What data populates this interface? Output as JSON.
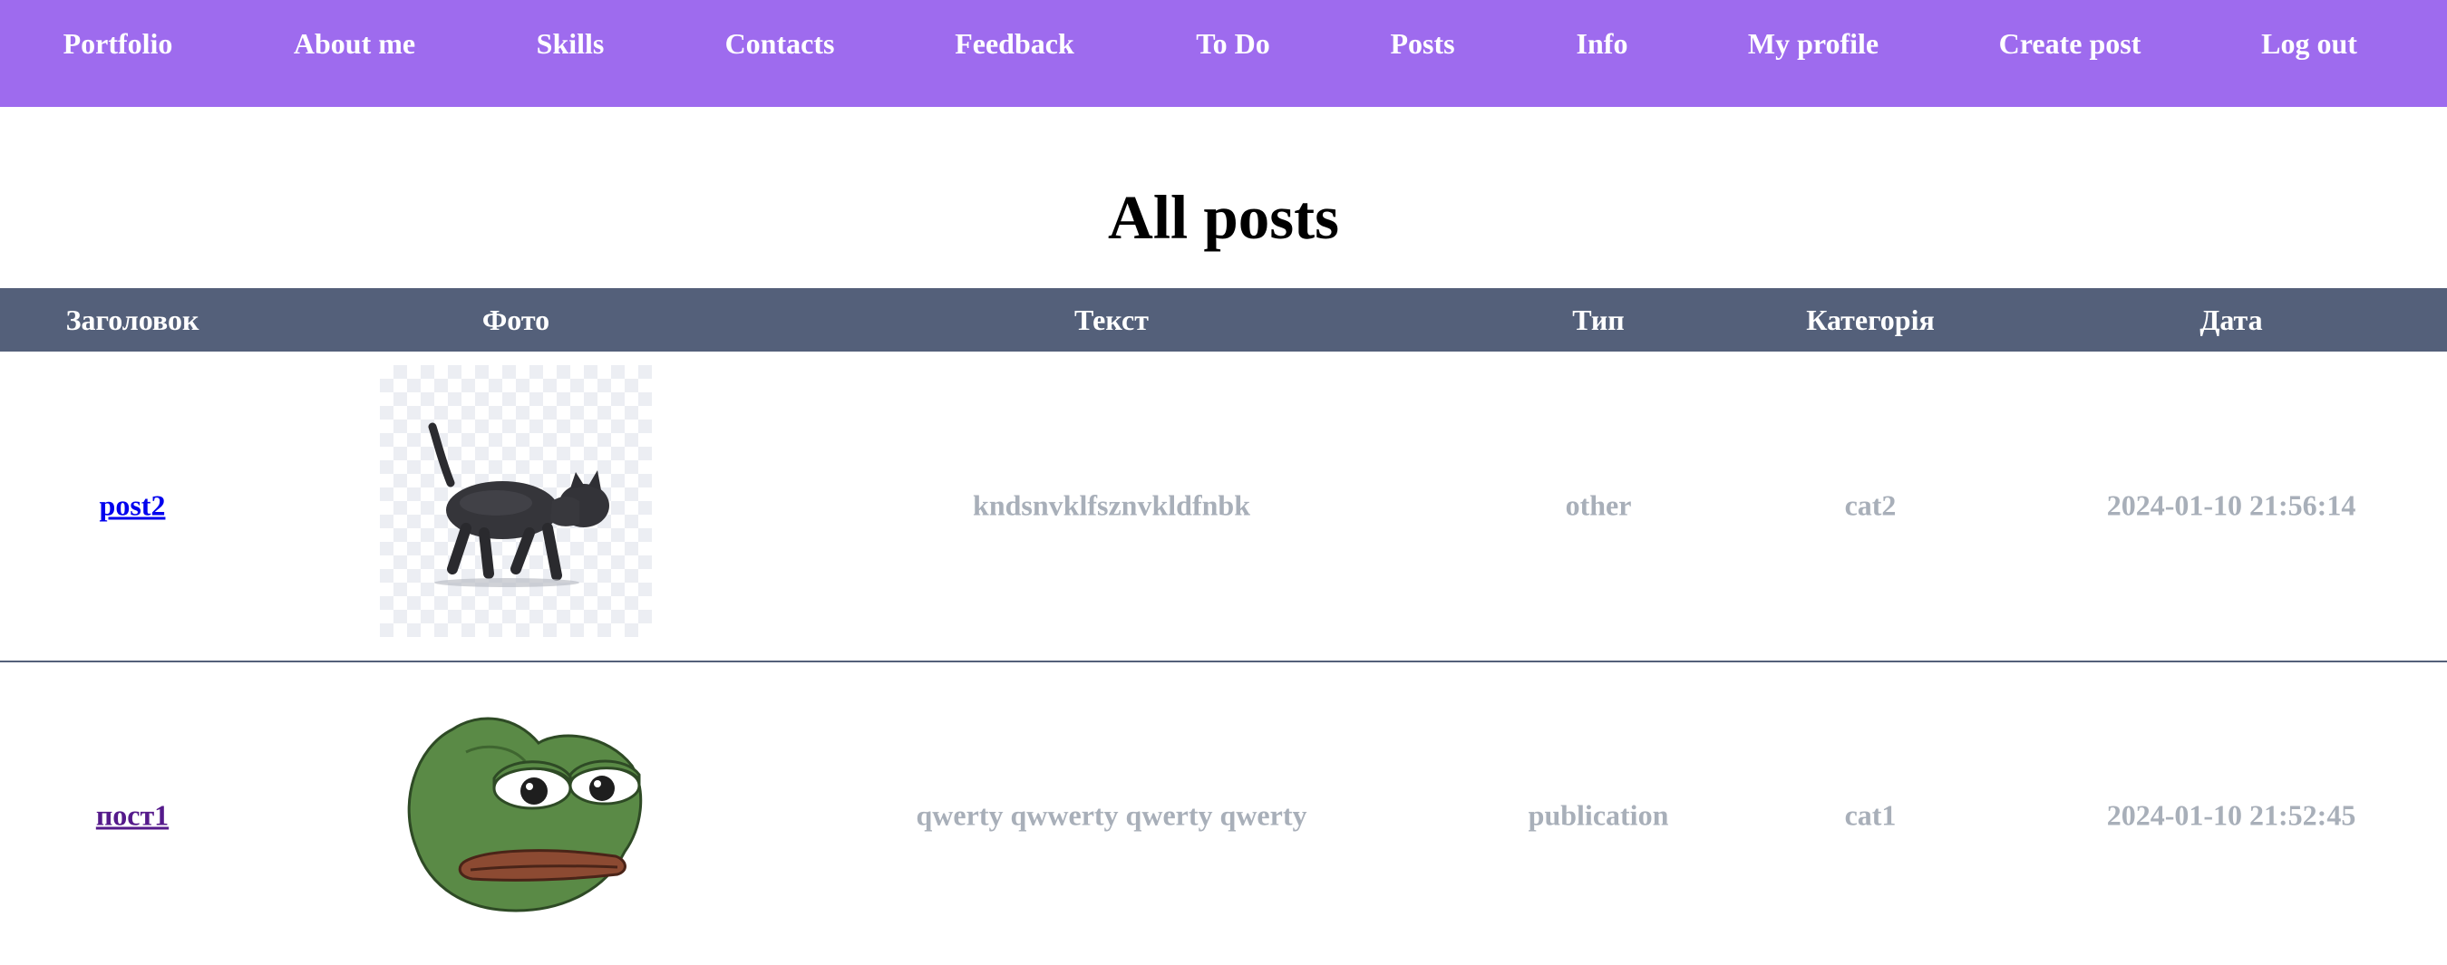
{
  "nav": {
    "items": [
      {
        "label": "Portfolio"
      },
      {
        "label": "About me"
      },
      {
        "label": "Skills"
      },
      {
        "label": "Contacts"
      },
      {
        "label": "Feedback"
      },
      {
        "label": "To Do"
      },
      {
        "label": "Posts"
      },
      {
        "label": "Info"
      },
      {
        "label": "My profile"
      },
      {
        "label": "Create post"
      },
      {
        "label": "Log out"
      }
    ]
  },
  "page": {
    "title": "All posts"
  },
  "table": {
    "headers": [
      "Заголовок",
      "Фото",
      "Текст",
      "Тип",
      "Категорія",
      "Дата"
    ],
    "rows": [
      {
        "title": "post2",
        "photo_icon": "walking-cat-image",
        "text": "kndsnvklfsznvkldfnbk",
        "type": "other",
        "category": "cat2",
        "date": "2024-01-10 21:56:14"
      },
      {
        "title": "пост1",
        "photo_icon": "sad-frog-image",
        "text": "qwerty qwwerty qwerty qwerty",
        "type": "publication",
        "category": "cat1",
        "date": "2024-01-10 21:52:45"
      }
    ]
  },
  "colors": {
    "nav_bg": "#9e6bee",
    "header_bg": "#54607a",
    "muted_text": "#a8afb9",
    "link": "#0000ee",
    "visited_link": "#551a8b"
  }
}
